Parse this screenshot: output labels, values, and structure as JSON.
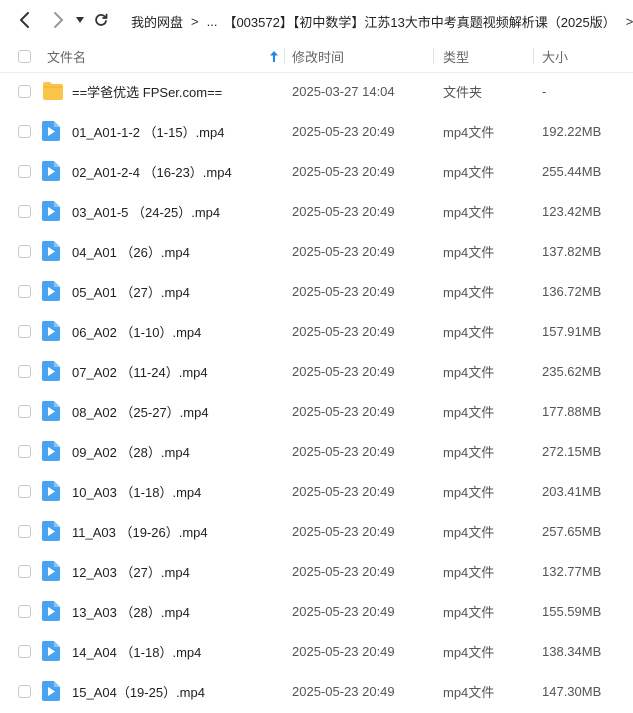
{
  "breadcrumb": {
    "root": "我的网盘",
    "ellipsis": "...",
    "current": "【003572】【初中数学】江苏13大市中考真题视频解析课（2025版）"
  },
  "columns": {
    "name": "文件名",
    "modified": "修改时间",
    "type": "类型",
    "size": "大小"
  },
  "files": [
    {
      "name": "==学爸优选 FPSer.com==",
      "modified": "2025-03-27 14:04",
      "type": "文件夹",
      "size": "-",
      "icon": "folder-icon"
    },
    {
      "name": "01_A01-1-2 （1-15）.mp4",
      "modified": "2025-05-23 20:49",
      "type": "mp4文件",
      "size": "192.22MB",
      "icon": "video-file-icon"
    },
    {
      "name": "02_A01-2-4 （16-23）.mp4",
      "modified": "2025-05-23 20:49",
      "type": "mp4文件",
      "size": "255.44MB",
      "icon": "video-file-icon"
    },
    {
      "name": "03_A01-5 （24-25）.mp4",
      "modified": "2025-05-23 20:49",
      "type": "mp4文件",
      "size": "123.42MB",
      "icon": "video-file-icon"
    },
    {
      "name": "04_A01 （26）.mp4",
      "modified": "2025-05-23 20:49",
      "type": "mp4文件",
      "size": "137.82MB",
      "icon": "video-file-icon"
    },
    {
      "name": "05_A01 （27）.mp4",
      "modified": "2025-05-23 20:49",
      "type": "mp4文件",
      "size": "136.72MB",
      "icon": "video-file-icon"
    },
    {
      "name": "06_A02 （1-10）.mp4",
      "modified": "2025-05-23 20:49",
      "type": "mp4文件",
      "size": "157.91MB",
      "icon": "video-file-icon"
    },
    {
      "name": "07_A02 （11-24）.mp4",
      "modified": "2025-05-23 20:49",
      "type": "mp4文件",
      "size": "235.62MB",
      "icon": "video-file-icon"
    },
    {
      "name": "08_A02 （25-27）.mp4",
      "modified": "2025-05-23 20:49",
      "type": "mp4文件",
      "size": "177.88MB",
      "icon": "video-file-icon"
    },
    {
      "name": "09_A02 （28）.mp4",
      "modified": "2025-05-23 20:49",
      "type": "mp4文件",
      "size": "272.15MB",
      "icon": "video-file-icon"
    },
    {
      "name": "10_A03 （1-18）.mp4",
      "modified": "2025-05-23 20:49",
      "type": "mp4文件",
      "size": "203.41MB",
      "icon": "video-file-icon"
    },
    {
      "name": "11_A03 （19-26）.mp4",
      "modified": "2025-05-23 20:49",
      "type": "mp4文件",
      "size": "257.65MB",
      "icon": "video-file-icon"
    },
    {
      "name": "12_A03 （27）.mp4",
      "modified": "2025-05-23 20:49",
      "type": "mp4文件",
      "size": "132.77MB",
      "icon": "video-file-icon"
    },
    {
      "name": "13_A03 （28）.mp4",
      "modified": "2025-05-23 20:49",
      "type": "mp4文件",
      "size": "155.59MB",
      "icon": "video-file-icon"
    },
    {
      "name": "14_A04 （1-18）.mp4",
      "modified": "2025-05-23 20:49",
      "type": "mp4文件",
      "size": "138.34MB",
      "icon": "video-file-icon"
    },
    {
      "name": "15_A04（19-25）.mp4",
      "modified": "2025-05-23 20:49",
      "type": "mp4文件",
      "size": "147.30MB",
      "icon": "video-file-icon"
    }
  ],
  "colors": {
    "folder": "#f9c64a",
    "video": "#4aa3f2",
    "sort_arrow": "#1e88e5"
  }
}
